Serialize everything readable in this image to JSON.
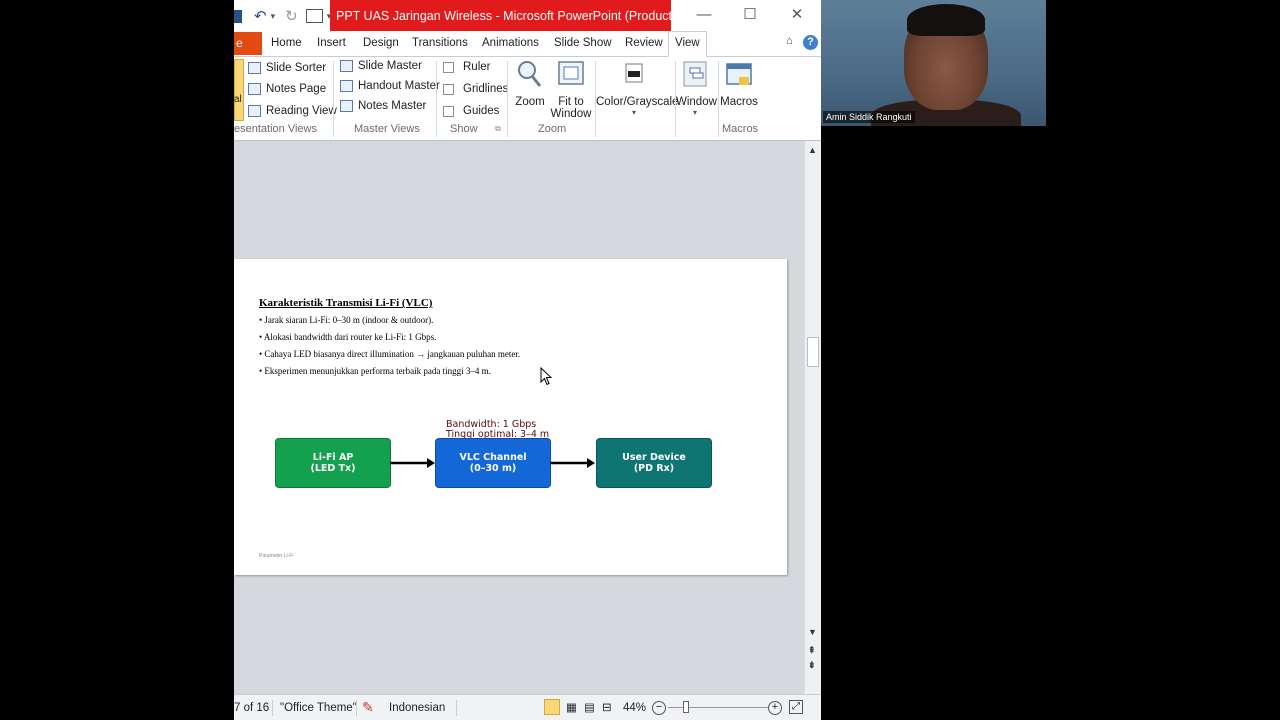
{
  "window": {
    "title": "PPT UAS Jaringan Wireless - Microsoft PowerPoint (Product ...",
    "minimize": "—",
    "maximize": "☐",
    "close": "✕"
  },
  "qat": {
    "undo": "↶",
    "redo": "↻",
    "dropdown": "▾"
  },
  "tabs": {
    "file": "e",
    "items": [
      "Home",
      "Insert",
      "Design",
      "Transitions",
      "Animations",
      "Slide Show",
      "Review",
      "View"
    ],
    "active": "View"
  },
  "ribbon": {
    "presentation_views": {
      "label": "esentation Views",
      "slide_sorter": "Slide Sorter",
      "notes_page": "Notes Page",
      "reading_view": "Reading View",
      "normal": "al"
    },
    "master_views": {
      "label": "Master Views",
      "slide_master": "Slide Master",
      "handout_master": "Handout Master",
      "notes_master": "Notes Master"
    },
    "show": {
      "label": "Show",
      "ruler": "Ruler",
      "gridlines": "Gridlines",
      "guides": "Guides"
    },
    "zoom": {
      "label": "Zoom",
      "zoom": "Zoom",
      "fit_line1": "Fit to",
      "fit_line2": "Window"
    },
    "color": {
      "label": "Color/Grayscale"
    },
    "window": {
      "label": "Window"
    },
    "macros": {
      "label": "Macros",
      "button": "Macros"
    }
  },
  "slide": {
    "title": "Karakteristik Transmisi Li-Fi (VLC)",
    "bullets": [
      "• Jarak siaran Li-Fi:  0–30 m (indoor & outdoor).",
      "• Alokasi  bandwidth dari router ke Li-Fi:  1 Gbps.",
      "• Cahaya LED  biasanya direct illumination   → jangkauan  puluhan meter.",
      "• Eksperimen  menunjukkan  performa terbaik pada tinggi  3–4 m."
    ],
    "annotation_line1": "Bandwidth: 1 Gbps",
    "annotation_line2": "Tinggi optimal: 3–4 m",
    "boxes": [
      {
        "line1": "Li-Fi AP",
        "line2": "(LED Tx)",
        "color": "#13a04f"
      },
      {
        "line1": "VLC Channel",
        "line2": "(0–30 m)",
        "color": "#1467d6"
      },
      {
        "line1": "User Device",
        "line2": "(PD Rx)",
        "color": "#0f7572"
      }
    ],
    "footer": "Parameter Li-Fi"
  },
  "status": {
    "slide": "7 of 16",
    "theme": "\"Office Theme\"",
    "language": "Indonesian",
    "zoom": "44%"
  },
  "video": {
    "participant": "Amin Siddik Rangkuti"
  },
  "colors": {
    "title_bar": "#e11b1b",
    "file_tab": "#e14a12",
    "arrow": "#000000"
  }
}
